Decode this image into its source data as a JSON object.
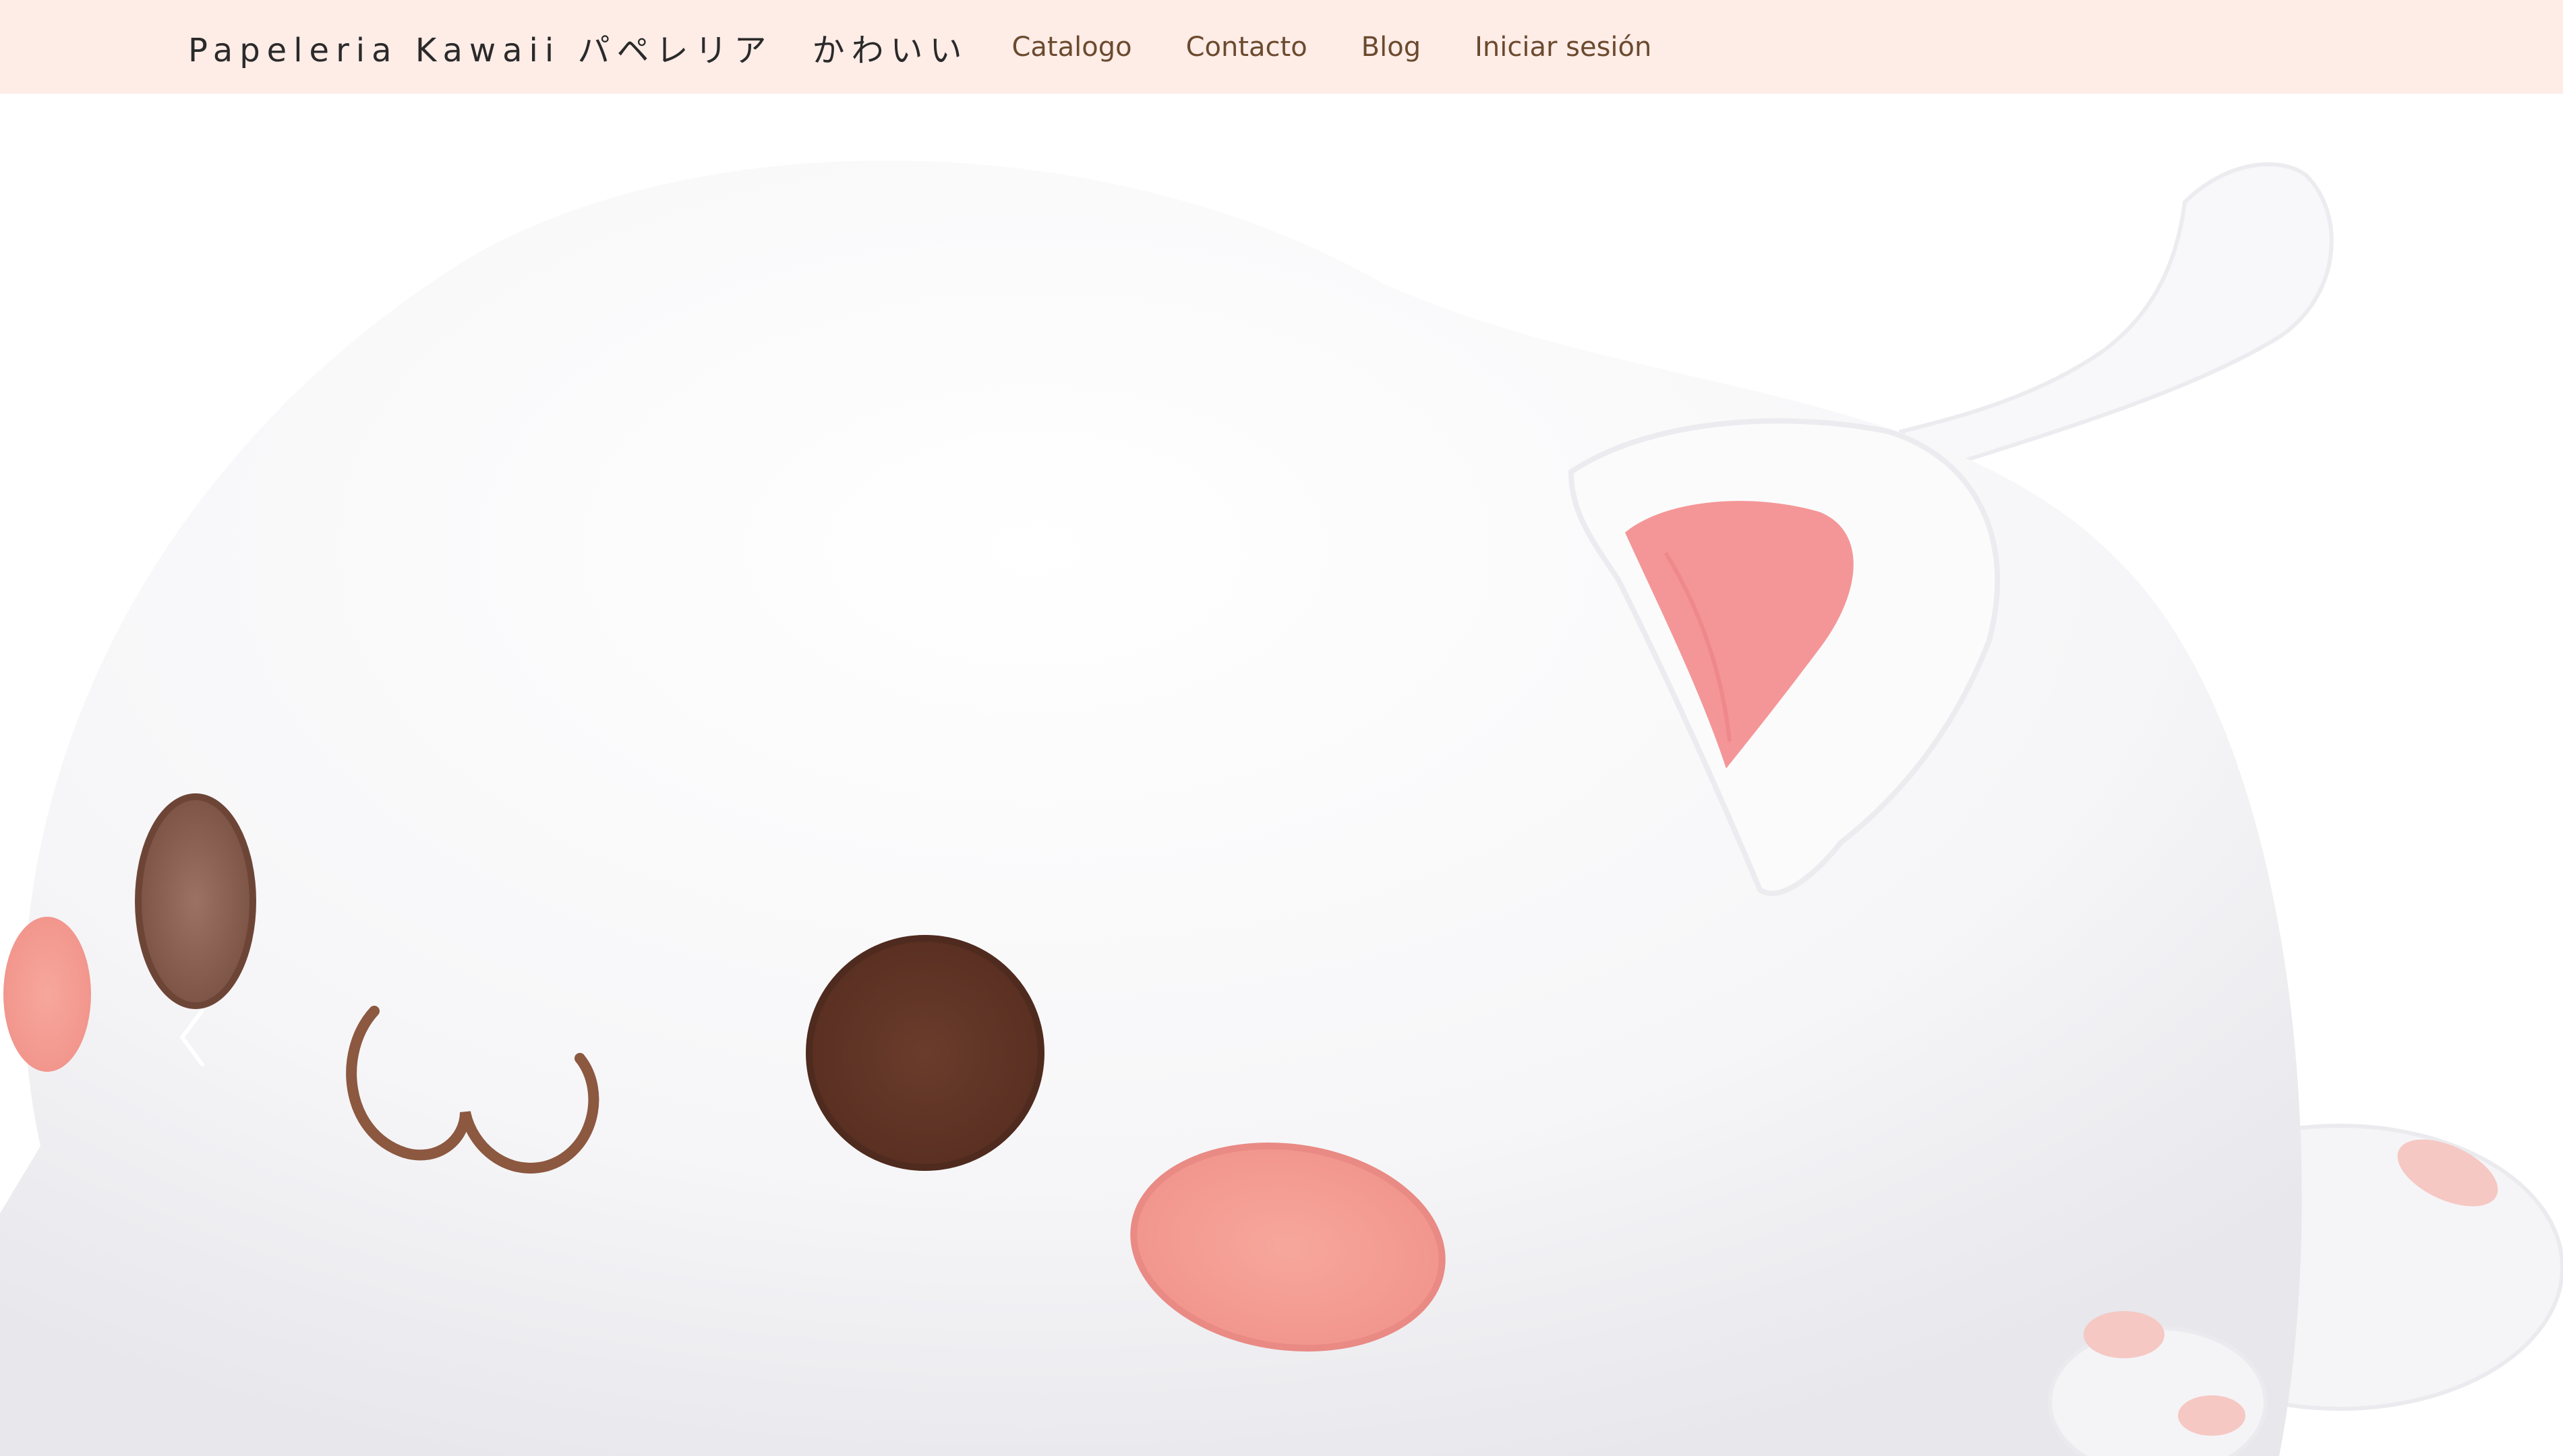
{
  "navbar": {
    "brand": "Papeleria Kawaii パペレリア　かわいい",
    "links": [
      {
        "label": "Catalogo"
      },
      {
        "label": "Contacto"
      },
      {
        "label": "Blog"
      },
      {
        "label": "Iniciar sesión"
      }
    ],
    "background": "#feece7",
    "link_color": "#6b4a2e"
  },
  "carousel": {
    "slide_image": "white-cat-plush",
    "prev_control_icon": "chevron-left-icon",
    "colors": {
      "plush_white": "#f7f7f9",
      "eye_brown": "#6e3f2e",
      "cheek_pink": "#f4a59a",
      "ear_pink": "#f08f92"
    }
  }
}
